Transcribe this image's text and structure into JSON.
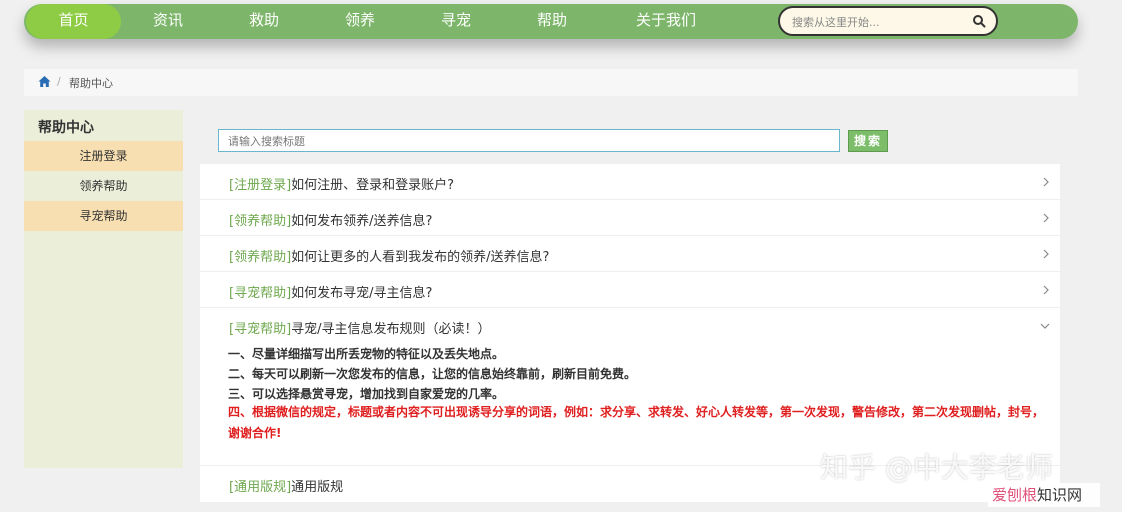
{
  "nav": {
    "items": [
      {
        "label": "首页",
        "active": true
      },
      {
        "label": "资讯",
        "active": false
      },
      {
        "label": "救助",
        "active": false
      },
      {
        "label": "领养",
        "active": false
      },
      {
        "label": "寻宠",
        "active": false
      },
      {
        "label": "帮助",
        "active": false
      },
      {
        "label": "关于我们",
        "active": false
      }
    ],
    "search_placeholder": "搜索从这里开始..."
  },
  "breadcrumb": {
    "separator": "/",
    "current": "帮助中心"
  },
  "sidebar": {
    "title": "帮助中心",
    "items": [
      {
        "label": "注册登录",
        "highlighted": true
      },
      {
        "label": "领养帮助",
        "highlighted": false
      },
      {
        "label": "寻宠帮助",
        "highlighted": true
      }
    ]
  },
  "content": {
    "search_placeholder": "请输入搜索标题",
    "search_button": "搜索",
    "faq": [
      {
        "tag": "[注册登录]",
        "question": "如何注册、登录和登录账户?"
      },
      {
        "tag": "[领养帮助]",
        "question": "如何发布领养/送养信息?"
      },
      {
        "tag": "[领养帮助]",
        "question": "如何让更多的人看到我发布的领养/送养信息?"
      },
      {
        "tag": "[寻宠帮助]",
        "question": "如何发布寻宠/寻主信息?"
      },
      {
        "tag": "[寻宠帮助]",
        "question": "寻宠/寻主信息发布规则（必读！）",
        "expanded": true
      }
    ],
    "rules": [
      "一、尽量详细描写出所丢宠物的特征以及丢失地点。",
      "二、每天可以刷新一次您发布的信息，让您的信息始终靠前，刷新目前免费。",
      "三、可以选择悬赏寻宠，增加找到自家爱宠的几率。",
      "四、根据微信的规定，标题或者内容不可出现诱导分享的词语，例如：求分享、求转发、好心人转发等，第一次发现，警告修改，第二次发现删帖，封号，谢谢合作!"
    ],
    "last_item": {
      "tag": "[通用版规]",
      "question": "通用版规"
    }
  },
  "watermark": {
    "line1": "知乎 @中大李老师",
    "line2_a": "爱刨根",
    "line2_b": "知识网"
  },
  "colors": {
    "nav_bg": "#7db66a",
    "nav_active": "#8fcc45",
    "tag_green": "#6ea84e",
    "rule_red": "#e02020",
    "sidebar_highlight": "#f7dfb2"
  }
}
